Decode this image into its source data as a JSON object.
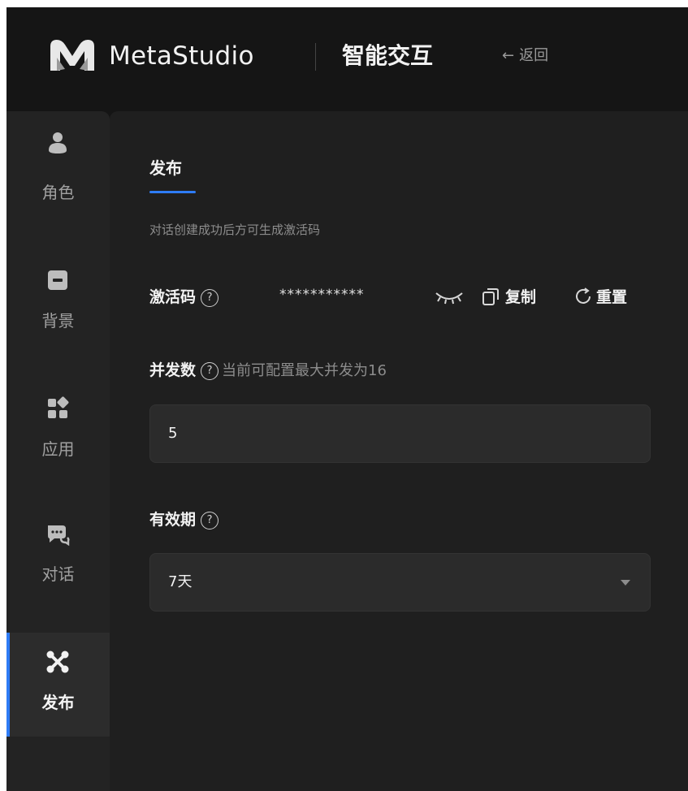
{
  "header": {
    "brand": "MetaStudio",
    "product": "智能交互",
    "back_arrow": "←",
    "back_label": "返回"
  },
  "sidebar": {
    "items": [
      {
        "label": "角色",
        "icon": "person-icon"
      },
      {
        "label": "背景",
        "icon": "background-icon"
      },
      {
        "label": "应用",
        "icon": "apps-icon"
      },
      {
        "label": "对话",
        "icon": "chat-icon"
      },
      {
        "label": "发布",
        "icon": "publish-icon",
        "active": true
      }
    ]
  },
  "main": {
    "tab_label": "发布",
    "hint": "对话创建成功后方可生成激活码",
    "activation_code": {
      "label": "激活码",
      "help_glyph": "?",
      "masked_value": "***********",
      "copy_label": "复制",
      "reset_label": "重置"
    },
    "concurrency": {
      "label": "并发数",
      "help_glyph": "?",
      "note": "当前可配置最大并发为16",
      "value": "5"
    },
    "validity": {
      "label": "有效期",
      "help_glyph": "?",
      "selected": "7天"
    }
  },
  "colors": {
    "accent": "#2e7cf6",
    "background": "#151515",
    "panel": "#1f1f1f",
    "sidebar": "#232323",
    "input": "#2b2b2b"
  }
}
